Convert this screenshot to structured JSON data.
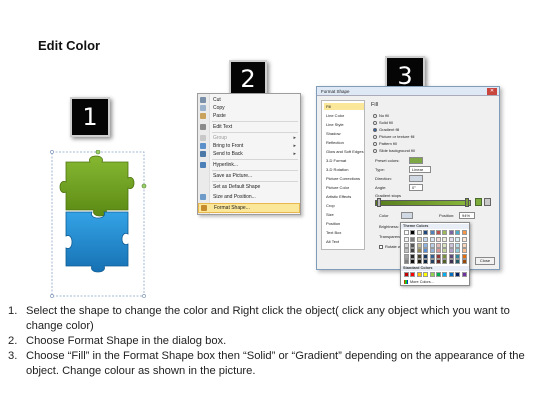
{
  "title": "Edit Color",
  "steps": [
    "1",
    "2",
    "3"
  ],
  "colors": {
    "puzzle_green": "#6e9e1e",
    "puzzle_blue": "#1e88cc",
    "highlight": "#fbe79a",
    "badge": "#050505"
  },
  "context_menu": {
    "items": [
      {
        "label": "Cut",
        "icon": "scissors-icon",
        "enabled": true
      },
      {
        "label": "Copy",
        "icon": "copy-icon",
        "enabled": true
      },
      {
        "label": "Paste",
        "icon": "paste-icon",
        "enabled": true
      },
      {
        "label": "Edit Text",
        "icon": "edit-text-icon",
        "enabled": true
      },
      {
        "label": "Group",
        "icon": "group-icon",
        "enabled": false,
        "submenu": true
      },
      {
        "label": "Bring to Front",
        "icon": "bring-front-icon",
        "enabled": true,
        "submenu": true
      },
      {
        "label": "Send to Back",
        "icon": "send-back-icon",
        "enabled": true,
        "submenu": true
      },
      {
        "label": "Hyperlink...",
        "icon": "hyperlink-icon",
        "enabled": true
      },
      {
        "label": "Save as Picture...",
        "icon": "",
        "enabled": true
      },
      {
        "label": "Set as Default Shape",
        "icon": "",
        "enabled": true
      },
      {
        "label": "Size and Position...",
        "icon": "size-icon",
        "enabled": true
      },
      {
        "label": "Format Shape...",
        "icon": "format-shape-icon",
        "enabled": true,
        "highlighted": true
      }
    ]
  },
  "format_dialog": {
    "title": "Format Shape",
    "sidebar": [
      "Fill",
      "Line Color",
      "Line Style",
      "Shadow",
      "Reflection",
      "Glow and Soft Edges",
      "3-D Format",
      "3-D Rotation",
      "Picture Corrections",
      "Picture Color",
      "Artistic Effects",
      "Crop",
      "Size",
      "Position",
      "Text Box",
      "Alt Text"
    ],
    "section": "Fill",
    "fill_options": [
      {
        "label": "No fill",
        "selected": false
      },
      {
        "label": "Solid fill",
        "selected": false
      },
      {
        "label": "Gradient fill",
        "selected": true
      },
      {
        "label": "Picture or texture fill",
        "selected": false
      },
      {
        "label": "Pattern fill",
        "selected": false
      },
      {
        "label": "Slide background fill",
        "selected": false
      }
    ],
    "preset_label": "Preset colors:",
    "type_label": "Type:",
    "type_value": "Linear",
    "direction_label": "Direction:",
    "angle_label": "Angle:",
    "angle_value": "0°",
    "stops_label": "Gradient stops",
    "color_label": "Color",
    "position_label": "Position:",
    "position_value": "94%",
    "brightness_label": "Brightness:",
    "transparency_label": "Transparency:",
    "rotate_label": "Rotate with shape",
    "close_label": "Close"
  },
  "palette": {
    "theme_label": "Theme Colors",
    "standard_label": "Standard Colors",
    "more_label": "More Colors...",
    "theme_rows": [
      [
        "#ffffff",
        "#000000",
        "#eeece1",
        "#1f497d",
        "#4f81bd",
        "#c0504d",
        "#9bbb59",
        "#8064a2",
        "#4bacc6",
        "#f79646"
      ],
      [
        "#f2f2f2",
        "#7f7f7f",
        "#ddd9c3",
        "#c6d9f0",
        "#dbe5f1",
        "#f2dcdb",
        "#ebf1dd",
        "#e5e0ec",
        "#dbeef3",
        "#fdeada"
      ],
      [
        "#d8d8d8",
        "#595959",
        "#c4bd97",
        "#8db3e2",
        "#b8cce4",
        "#e5b9b7",
        "#d7e3bc",
        "#ccc1d9",
        "#b7dde8",
        "#fbd5b5"
      ],
      [
        "#bfbfbf",
        "#3f3f3f",
        "#938953",
        "#548dd4",
        "#95b3d7",
        "#d99694",
        "#c3d69b",
        "#b2a2c7",
        "#92cddc",
        "#fac08f"
      ],
      [
        "#a5a5a5",
        "#262626",
        "#494429",
        "#17365d",
        "#366092",
        "#953734",
        "#76923c",
        "#5f497a",
        "#31859b",
        "#e36c09"
      ],
      [
        "#7f7f7f",
        "#0c0c0c",
        "#1d1b10",
        "#0f243e",
        "#244061",
        "#632423",
        "#4f6128",
        "#3f3151",
        "#205867",
        "#974806"
      ]
    ],
    "standard_row": [
      "#c00000",
      "#ff0000",
      "#ffc000",
      "#ffff00",
      "#92d050",
      "#00b050",
      "#00b0f0",
      "#0070c0",
      "#002060",
      "#7030a0"
    ]
  },
  "instructions": [
    {
      "num": "1.",
      "text": "Select the shape to change the color and Right click the object( click any object which you want to change color)"
    },
    {
      "num": "2.",
      "text": "Choose Format Shape in the dialog box."
    },
    {
      "num": "3.",
      "text": "Choose “Fill” in the Format Shape box then “Solid” or “Gradient” depending on the appearance of the object. Change colour as shown in the picture."
    }
  ]
}
